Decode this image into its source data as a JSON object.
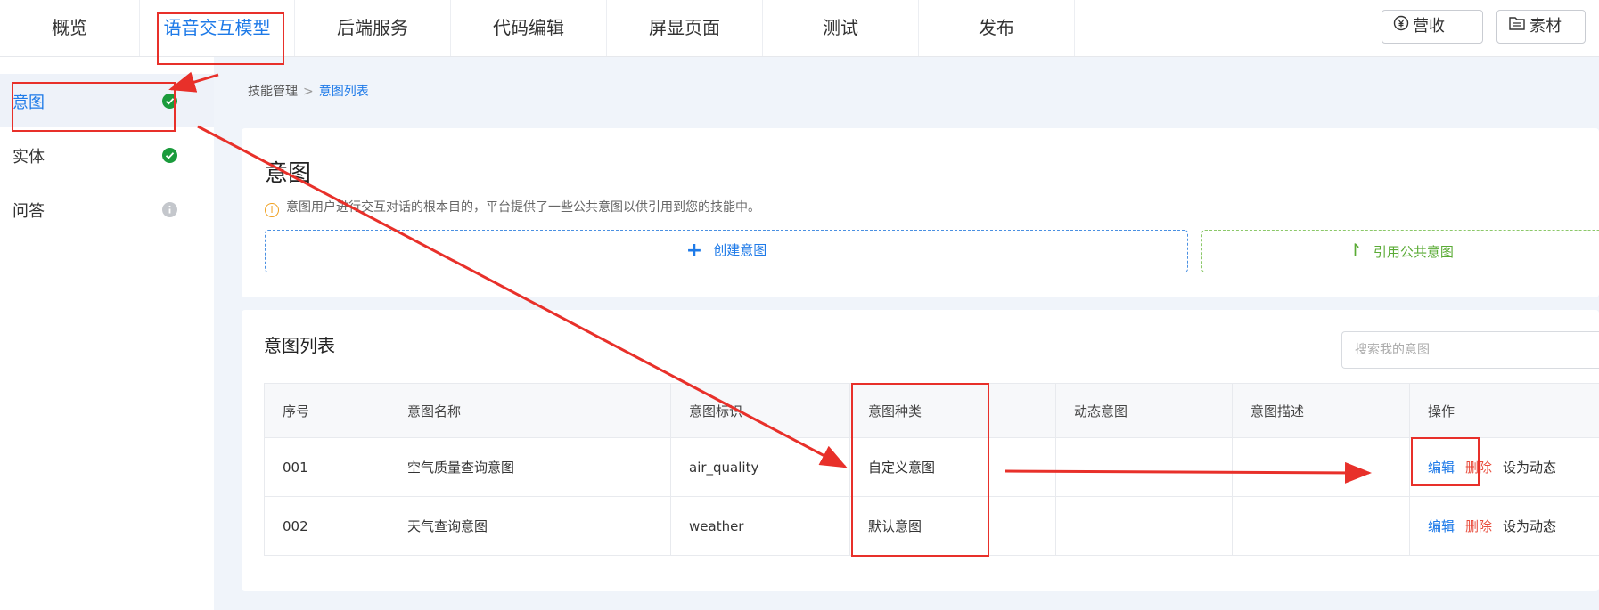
{
  "topnav": {
    "tabs": [
      {
        "label": "概览"
      },
      {
        "label": "语音交互模型"
      },
      {
        "label": "后端服务"
      },
      {
        "label": "代码编辑"
      },
      {
        "label": "屏显页面"
      },
      {
        "label": "测试"
      },
      {
        "label": "发布"
      }
    ],
    "revenue_label": "营收",
    "material_label": "素材"
  },
  "sidebar": {
    "items": [
      {
        "label": "意图",
        "status": "done"
      },
      {
        "label": "实体",
        "status": "done"
      },
      {
        "label": "问答",
        "status": "info"
      }
    ]
  },
  "breadcrumb": {
    "parent": "技能管理",
    "separator": ">",
    "current": "意图列表"
  },
  "intent_card": {
    "title": "意图",
    "hint": "意图用户进行交互对话的根本目的，平台提供了一些公共意图以供引用到您的技能中。",
    "create_label": "创建意图",
    "reference_label": "引用公共意图"
  },
  "list_card": {
    "title": "意图列表",
    "search_placeholder": "搜索我的意图",
    "columns": [
      "序号",
      "意图名称",
      "意图标识",
      "意图种类",
      "动态意图",
      "意图描述",
      "操作"
    ],
    "rows": [
      {
        "no": "001",
        "name": "空气质量查询意图",
        "id": "air_quality",
        "kind": "自定义意图",
        "dynamic": "",
        "desc": ""
      },
      {
        "no": "002",
        "name": "天气查询意图",
        "id": "weather",
        "kind": "默认意图",
        "dynamic": "",
        "desc": ""
      }
    ],
    "actions": {
      "edit": "编辑",
      "delete": "删除",
      "set_dynamic": "设为动态"
    }
  },
  "colors": {
    "accent": "#1e7ae8",
    "success": "#1a9b3c",
    "danger": "#e84a3a",
    "annotation": "#e8302a",
    "reference_green": "#5aab35"
  }
}
